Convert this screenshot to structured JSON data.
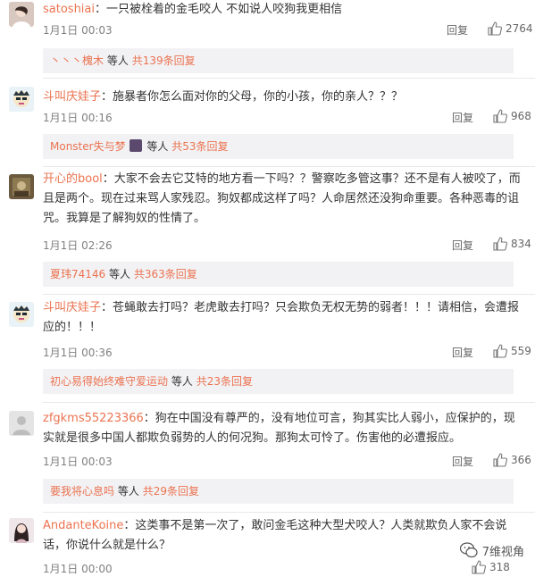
{
  "comments": [
    {
      "user": "satoshiai",
      "text": "：一只被栓着的金毛咬人 不如说人咬狗我更相信",
      "time": "1月1日 00:03",
      "reply_label": "回复",
      "likes": "2764",
      "sub": {
        "names": "丶丶丶槐木",
        "etal": "等人",
        "total": "共139条回复"
      }
    },
    {
      "user": "斗叫庆娃子",
      "text": "：施暴者你怎么面对你的父母，你的小孩，你的亲人？？？",
      "time": "1月1日 00:16",
      "reply_label": "回复",
      "likes": "968",
      "sub": {
        "names": "Monster失与梦",
        "etal": "等人",
        "total": "共53条回复"
      }
    },
    {
      "user": "开心的bool",
      "text": "：大家不会去它艾特的地方看一下吗？？警察吃多管这事？还不是有人被咬了，而且是两个。现在过来骂人家残忍。狗奴都成这样了吗？人命居然还没狗命重要。各种恶毒的诅咒。我算是了解狗奴的性情了。",
      "time": "1月1日 02:26",
      "reply_label": "回复",
      "likes": "834",
      "sub": {
        "names": "夏玮74146",
        "etal": "等人",
        "total": "共363条回复"
      }
    },
    {
      "user": "斗叫庆娃子",
      "text": "：苍蝇敢去打吗？老虎敢去打吗？只会欺负无权无势的弱者！！！请相信，会遭报应的！！！",
      "time": "1月1日 00:36",
      "reply_label": "回复",
      "likes": "559",
      "sub": {
        "names": "初心易得始终难守爱运动",
        "etal": "等人",
        "total": "共23条回复"
      }
    },
    {
      "user": "zfgkms55223366",
      "text": "：狗在中国没有尊严的，没有地位可言，狗其实比人弱小，应保护的，现实就是很多中国人都欺负弱势的人的何况狗。那狗太可怜了。伤害他的必遭报应。",
      "time": "1月1日 00:03",
      "reply_label": "回复",
      "likes": "366",
      "sub": {
        "names": "要我将心息吗",
        "etal": "等人",
        "total": "共29条回复"
      }
    },
    {
      "user": "AndanteKoine",
      "text": "：这类事不是第一次了，敢问金毛这种大型犬咬人？人类就欺负人家不会说话，你说什么就是什么？",
      "time": "1月1日 00:00",
      "reply_label": "回复",
      "likes": "318",
      "sub": null
    }
  ],
  "watermark": "7维视角",
  "icons": {
    "like": "thumbs-up-icon",
    "avatar": "user-avatar"
  },
  "colors": {
    "accent": "#eb7350",
    "meta": "#808080",
    "subbg": "#f2f2f5"
  }
}
